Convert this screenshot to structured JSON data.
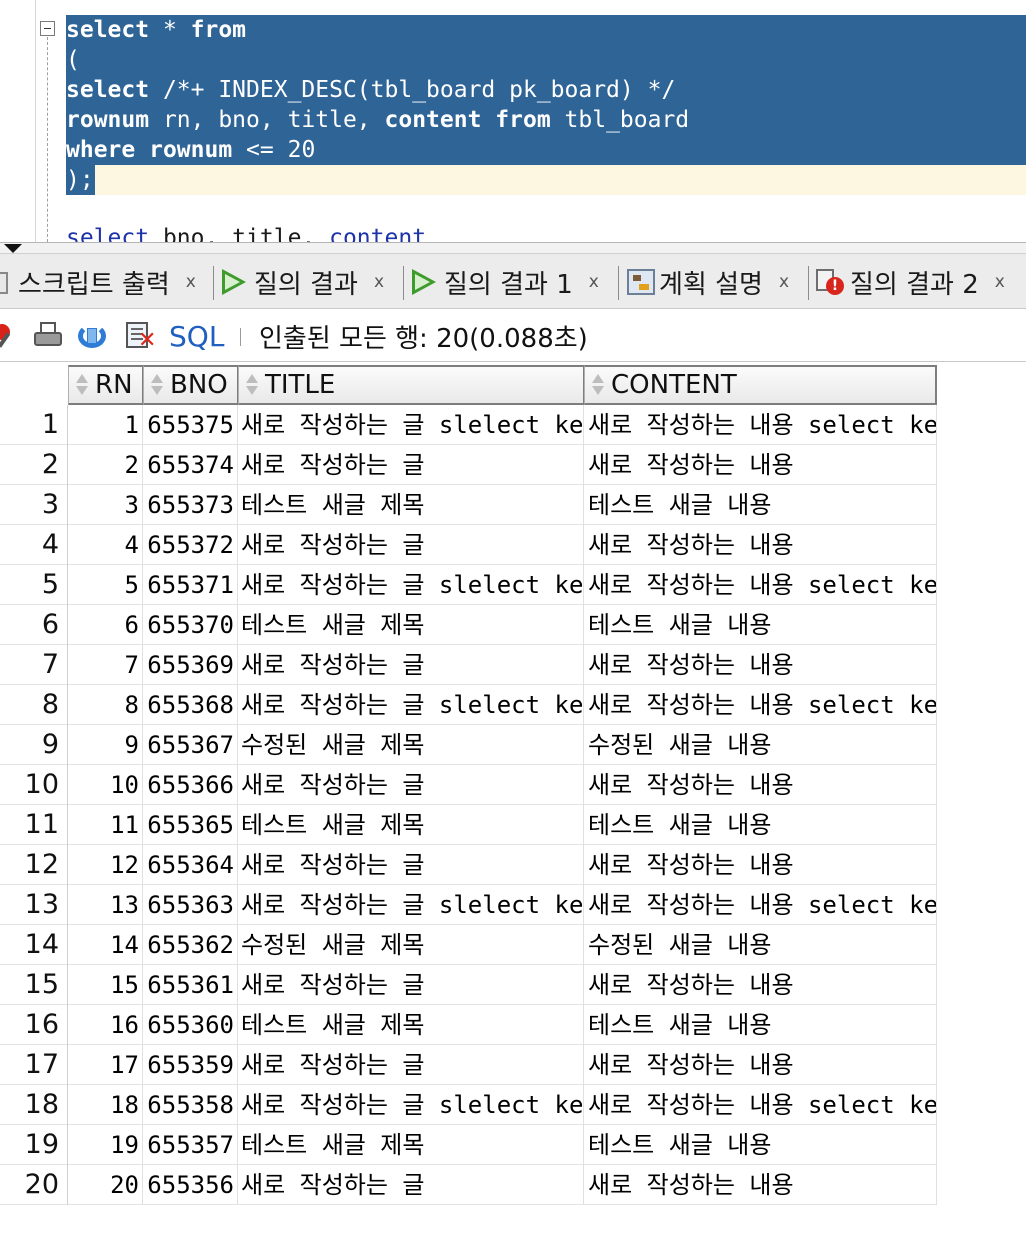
{
  "editor": {
    "lines": [
      [
        {
          "t": "select",
          "kw": true
        },
        {
          "t": " * "
        },
        {
          "t": "from",
          "kw": true
        }
      ],
      [
        {
          "t": "("
        }
      ],
      [
        {
          "t": "select",
          "kw": true
        },
        {
          "t": " /*+ INDEX_DESC(tbl_board pk_board) */"
        }
      ],
      [
        {
          "t": "rownum",
          "kw": true
        },
        {
          "t": " rn, bno, title, "
        },
        {
          "t": "content",
          "kw": true
        },
        {
          "t": " "
        },
        {
          "t": "from",
          "kw": true
        },
        {
          "t": " tbl_board"
        }
      ],
      [
        {
          "t": "where",
          "kw": true
        },
        {
          "t": " "
        },
        {
          "t": "rownum",
          "kw": true
        },
        {
          "t": " <= 20"
        }
      ],
      [
        {
          "t": ");"
        }
      ],
      [
        {
          "t": "select",
          "kw": true
        },
        {
          "t": " bno, title, "
        },
        {
          "t": "content",
          "kw": true
        }
      ]
    ]
  },
  "tabs": [
    {
      "label": "스크립트 출력",
      "icon": "script-output-icon",
      "close": "x"
    },
    {
      "label": "질의 결과",
      "icon": "play-icon",
      "close": "x"
    },
    {
      "label": "질의 결과 1",
      "icon": "play-icon",
      "close": "x"
    },
    {
      "label": "계획 설명",
      "icon": "explain-plan-icon",
      "close": "x"
    },
    {
      "label": "질의 결과 2",
      "icon": "error-icon",
      "close": "x"
    }
  ],
  "toolbar": {
    "sql_label": "SQL",
    "status": "인출된 모든 행: 20(0.088초)"
  },
  "grid": {
    "columns": [
      "RN",
      "BNO",
      "TITLE",
      "CONTENT"
    ],
    "rows": [
      [
        "1",
        "1",
        "655375",
        "새로 작성하는 글 slelect key",
        "새로 작성하는 내용 select key"
      ],
      [
        "2",
        "2",
        "655374",
        "새로 작성하는 글",
        "새로 작성하는 내용"
      ],
      [
        "3",
        "3",
        "655373",
        "테스트 새글 제목",
        "테스트 새글 내용"
      ],
      [
        "4",
        "4",
        "655372",
        "새로 작성하는 글",
        "새로 작성하는 내용"
      ],
      [
        "5",
        "5",
        "655371",
        "새로 작성하는 글 slelect key",
        "새로 작성하는 내용 select key"
      ],
      [
        "6",
        "6",
        "655370",
        "테스트 새글 제목",
        "테스트 새글 내용"
      ],
      [
        "7",
        "7",
        "655369",
        "새로 작성하는 글",
        "새로 작성하는 내용"
      ],
      [
        "8",
        "8",
        "655368",
        "새로 작성하는 글 slelect key",
        "새로 작성하는 내용 select key"
      ],
      [
        "9",
        "9",
        "655367",
        "수정된 새글 제목",
        "수정된 새글 내용"
      ],
      [
        "10",
        "10",
        "655366",
        "새로 작성하는 글",
        "새로 작성하는 내용"
      ],
      [
        "11",
        "11",
        "655365",
        "테스트 새글 제목",
        "테스트 새글 내용"
      ],
      [
        "12",
        "12",
        "655364",
        "새로 작성하는 글",
        "새로 작성하는 내용"
      ],
      [
        "13",
        "13",
        "655363",
        "새로 작성하는 글 slelect key",
        "새로 작성하는 내용 select key"
      ],
      [
        "14",
        "14",
        "655362",
        "수정된 새글 제목",
        "수정된 새글 내용"
      ],
      [
        "15",
        "15",
        "655361",
        "새로 작성하는 글",
        "새로 작성하는 내용"
      ],
      [
        "16",
        "16",
        "655360",
        "테스트 새글 제목",
        "테스트 새글 내용"
      ],
      [
        "17",
        "17",
        "655359",
        "새로 작성하는 글",
        "새로 작성하는 내용"
      ],
      [
        "18",
        "18",
        "655358",
        "새로 작성하는 글 slelect key",
        "새로 작성하는 내용 select key"
      ],
      [
        "19",
        "19",
        "655357",
        "테스트 새글 제목",
        "테스트 새글 내용"
      ],
      [
        "20",
        "20",
        "655356",
        "새로 작성하는 글",
        "새로 작성하는 내용"
      ]
    ]
  },
  "colors": {
    "selection": "#2f6496",
    "current_line": "#fdf7e1",
    "sql_link": "#1f5fbf",
    "play_icon": "#3e9b2c",
    "error_icon": "#d9261c"
  }
}
